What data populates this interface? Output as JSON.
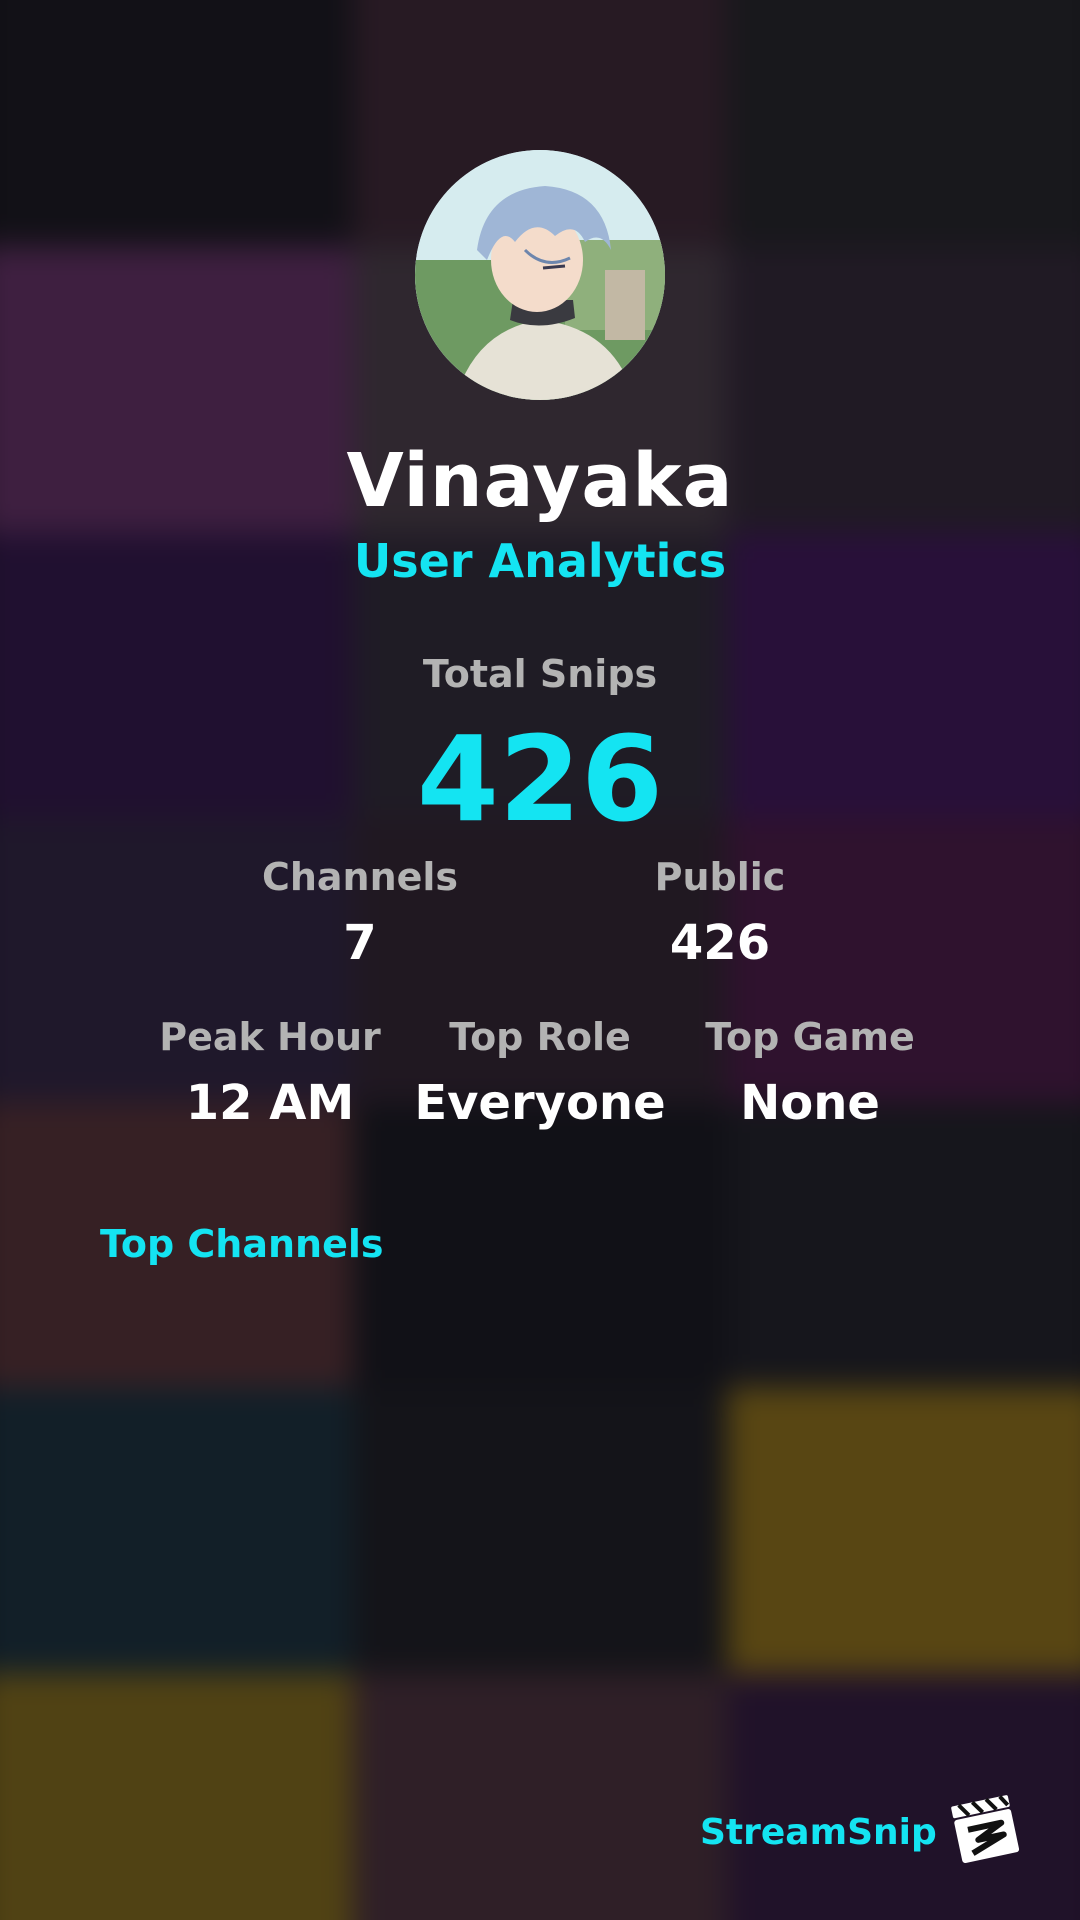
{
  "profile": {
    "avatar_icon": "avatar-anime-character-icon",
    "username": "Vinayaka",
    "subtitle": "User Analytics"
  },
  "stats": {
    "total_snips_label": "Total Snips",
    "total_snips_value": "426",
    "channels_label": "Channels",
    "channels_value": "7",
    "public_label": "Public",
    "public_value": "426",
    "peak_hour_label": "Peak Hour",
    "peak_hour_value": "12 AM",
    "top_role_label": "Top Role",
    "top_role_value": "Everyone",
    "top_game_label": "Top Game",
    "top_game_value": "None"
  },
  "sections": {
    "top_channels_title": "Top Channels"
  },
  "branding": {
    "name": "StreamSnip",
    "logo_icon": "clapperboard-logo-icon"
  },
  "colors": {
    "accent": "#14e4f2",
    "label": "#b3b3b3",
    "value": "#ffffff"
  }
}
